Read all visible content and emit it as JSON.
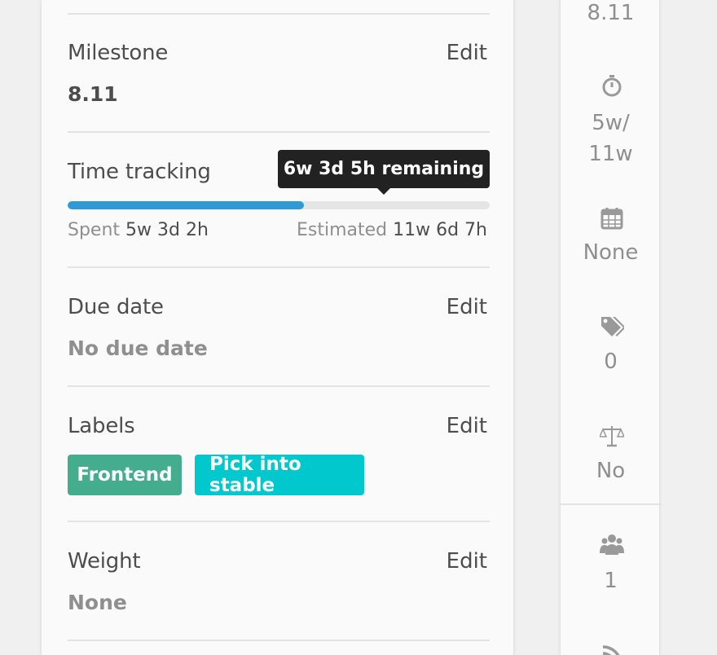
{
  "sidebar": {
    "milestone": {
      "title": "Milestone",
      "edit": "Edit",
      "value": "8.11"
    },
    "time_tracking": {
      "title": "Time tracking",
      "tooltip": "6w 3d 5h remaining",
      "progress_fraction": 0.56,
      "spent_label": "Spent",
      "spent_value": "5w 3d 2h",
      "estimated_label": "Estimated",
      "estimated_value": "11w 6d 7h"
    },
    "due_date": {
      "title": "Due date",
      "edit": "Edit",
      "value": "No due date"
    },
    "labels": {
      "title": "Labels",
      "edit": "Edit",
      "items": [
        {
          "name": "Frontend",
          "color": "#44ad8e"
        },
        {
          "name": "Pick into stable",
          "color": "#00c8cc"
        }
      ]
    },
    "weight": {
      "title": "Weight",
      "edit": "Edit",
      "value": "None"
    }
  },
  "collapsed_rail": {
    "milestone_value": "8.11",
    "time_spent": "5w/",
    "time_estimate": "11w",
    "due_date": "None",
    "labels_count": "0",
    "confidential": "No",
    "participants": "1",
    "icons": [
      "stopwatch-icon",
      "calendar-icon",
      "tags-icon",
      "balance-scale-icon",
      "users-icon",
      "rss-icon"
    ]
  },
  "colors": {
    "progress": "#2f9bd6",
    "tooltip_bg": "#222222",
    "muted_text": "#8f8f8f"
  }
}
